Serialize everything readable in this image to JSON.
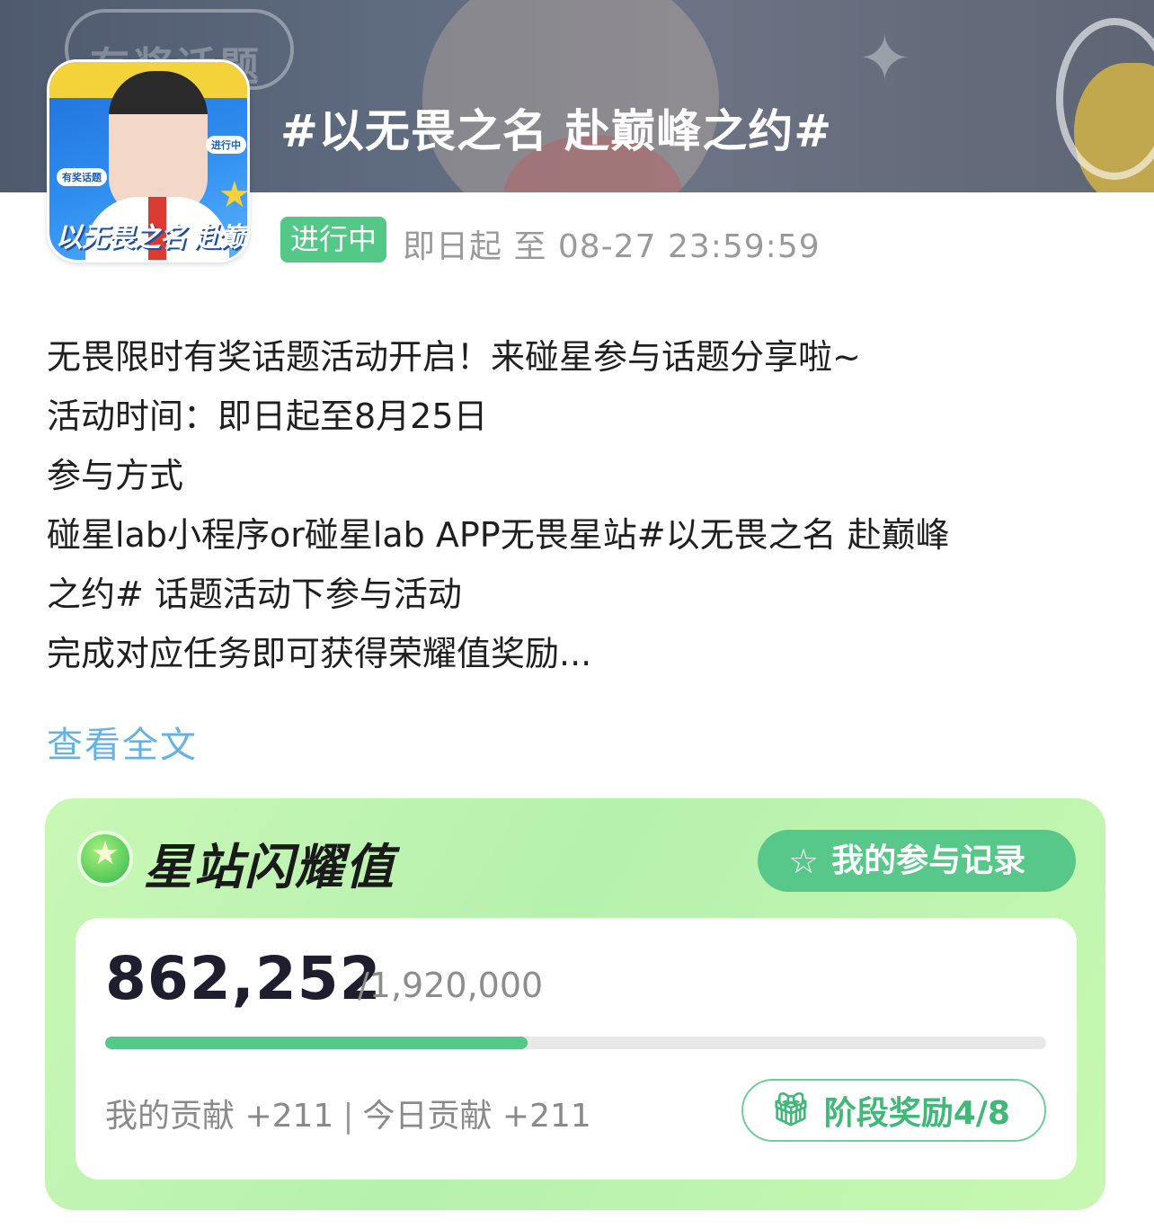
{
  "header": {
    "cover_badges": [
      "有奖话题",
      "进行中"
    ],
    "cover_script": "以无畏之名 赴巅峰之约",
    "banner_bubble": "有奖话题",
    "topic_title": "#以无畏之名 赴巅峰之约#"
  },
  "status": {
    "badge": "进行中",
    "time_range": "即日起 至 08-27 23:59:59"
  },
  "description": {
    "lines": [
      "无畏限时有奖话题活动开启！来碰星参与话题分享啦~",
      "活动时间：即日起至8月25日",
      "参与方式",
      "碰星lab小程序or碰星lab APP无畏星站#以无畏之名 赴巅峰",
      "之约# 话题活动下参与活动",
      "完成对应任务即可获得荣耀值奖励..."
    ],
    "read_more": "查看全文"
  },
  "card": {
    "title": "星站闪耀值",
    "record_button": "我的参与记录",
    "current_value": "862,252",
    "target_value": "/1,920,000",
    "progress_fraction": 0.449,
    "my_contribution": "我的贡献 +211",
    "separator": "|",
    "today_contribution": "今日贡献 +211",
    "stage_reward_button": "阶段奖励4/8",
    "accent_color": "#55c98a"
  }
}
